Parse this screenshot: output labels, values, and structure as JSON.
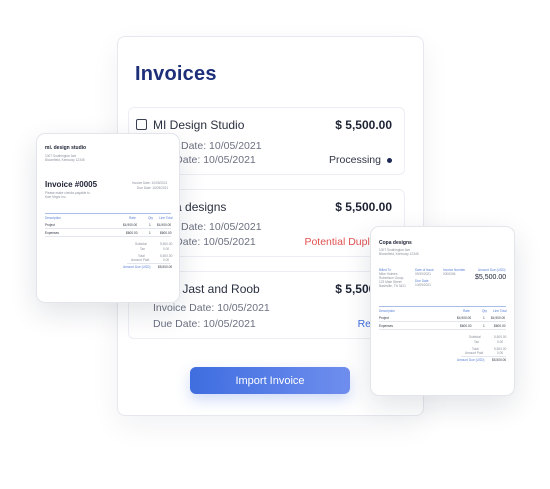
{
  "panel": {
    "title": "Invoices",
    "invoices": [
      {
        "vendor": "MI Design Studio",
        "amount": "$ 5,500.00",
        "issue_date": "Issue Date: 10/05/2021",
        "due_date": "Due Date: 10/05/2021",
        "status": "Processing",
        "status_color": "#2f3545"
      },
      {
        "vendor": "Copa designs",
        "amount": "$ 5,500.00",
        "issue_date": "Issue Date: 10/05/2021",
        "due_date": "Due Date: 10/05/2021",
        "status": "Potential Duplicate",
        "status_color": "#e05252"
      },
      {
        "vendor": "Hills, Jast and Roob",
        "amount": "$ 5,500.00",
        "issue_date": "Invoice Date: 10/05/2021",
        "due_date": "Due Date: 10/05/2021",
        "status": "Review",
        "status_color": "#3f6ee0"
      }
    ],
    "import_button": "Import Invoice"
  },
  "doc_left": {
    "logo": "mi. design studio",
    "address_1": "1007 Southington Ave",
    "address_2": "Bloomfield, Kentucky 12345",
    "invoice_title": "Invoice #0005",
    "invoice_date": "Invoice Date: 10/05/2021",
    "due_date": "Due Date: 10/05/2021",
    "payment_note_1": "Please make checks payable to",
    "payment_note_2": "Kwe Mrgnr Inc.",
    "columns": [
      "Description",
      "Rate",
      "Qty",
      "Line Total"
    ],
    "rows": [
      {
        "desc": "Project",
        "rate": "$4,900.00",
        "qty": "1",
        "total": "$4,900.00"
      },
      {
        "desc": "Expenses",
        "rate": "$600.00",
        "qty": "1",
        "total": "$600.00"
      }
    ],
    "subtotal_label": "Subtotal",
    "subtotal": "5,500.00",
    "tax_label": "Tax",
    "tax": "0.00",
    "total_label": "Total",
    "total": "5,500.00",
    "paid_label": "Amount Paid",
    "paid": "0.00",
    "due_label": "Amount Due (USD)",
    "due": "$5,500.00"
  },
  "doc_right": {
    "company": "Copa designs",
    "address_1": "1007 Southington Ave",
    "address_2": "Bloomfield, Kentucky 12345",
    "billed_to_label": "Billed To",
    "billed_to_1": "Mike Holmes",
    "billed_to_2": "Robertson Group",
    "billed_to_3": "123 Main Street",
    "billed_to_4": "Nashville, TN 3421",
    "date_issued_label": "Date of Issue",
    "date_issued": "09/30/2021",
    "invoice_no_label": "Invoice Number",
    "invoice_no": "0000006",
    "amount_due_label": "Amount Due (USD)",
    "amount_due": "$5,500.00",
    "due_date_label": "Due Date",
    "due_date": "10/05/2021",
    "columns": [
      "Description",
      "Rate",
      "Qty",
      "Line Total"
    ],
    "rows": [
      {
        "desc": "Project",
        "rate": "$4,900.00",
        "qty": "1",
        "total": "$4,900.00"
      },
      {
        "desc": "Expenses",
        "rate": "$600.00",
        "qty": "1",
        "total": "$600.00"
      }
    ],
    "subtotal_label": "Subtotal",
    "subtotal": "5,500.00",
    "tax_label": "Tax",
    "tax": "0.00",
    "total_label": "Total",
    "total": "5,500.00",
    "paid_label": "Amount Paid",
    "paid": "0.00",
    "due_label": "Amount Due (USD)",
    "due": "$5,500.00"
  }
}
